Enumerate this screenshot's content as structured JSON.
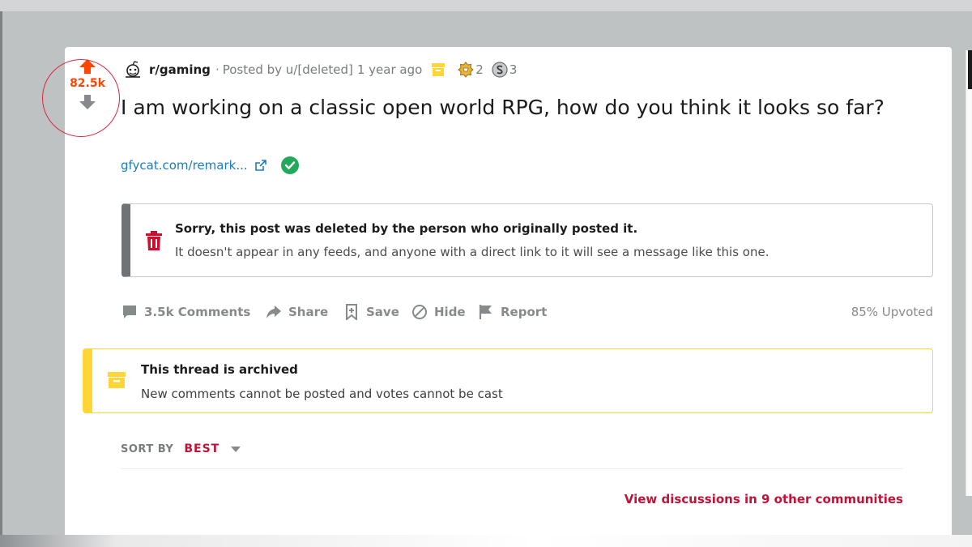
{
  "post": {
    "score": "82.5k",
    "subreddit": "r/gaming",
    "dot": "·",
    "posted_by": "Posted by u/[deleted]",
    "time": "1 year ago",
    "awards": [
      {
        "icon": "trophy-award-icon",
        "count": "2"
      },
      {
        "icon": "silver-award-icon",
        "count": "3"
      }
    ],
    "title": "I am working on a classic open world RPG, how do you think it looks so far?",
    "link_text": "gfycat.com/remark..."
  },
  "deleted_notice": {
    "heading": "Sorry, this post was deleted by the person who originally posted it.",
    "body": "It doesn't appear in any feeds, and anyone with a direct link to it will see a message like this one."
  },
  "actions": {
    "comments": "3.5k Comments",
    "share": "Share",
    "save": "Save",
    "hide": "Hide",
    "report": "Report",
    "upvoted": "85% Upvoted"
  },
  "archived_notice": {
    "heading": "This thread is archived",
    "body": "New comments cannot be posted and votes cannot be cast"
  },
  "sort": {
    "label": "SORT BY",
    "value": "BEST"
  },
  "discussions_link": "View discussions in 9 other communities",
  "colors": {
    "upvote_orange": "#ff4500",
    "link_blue": "#1a7dbf",
    "danger_red": "#c11237",
    "archive_yellow": "#ffd635",
    "muted_gray": "#878a8c"
  }
}
